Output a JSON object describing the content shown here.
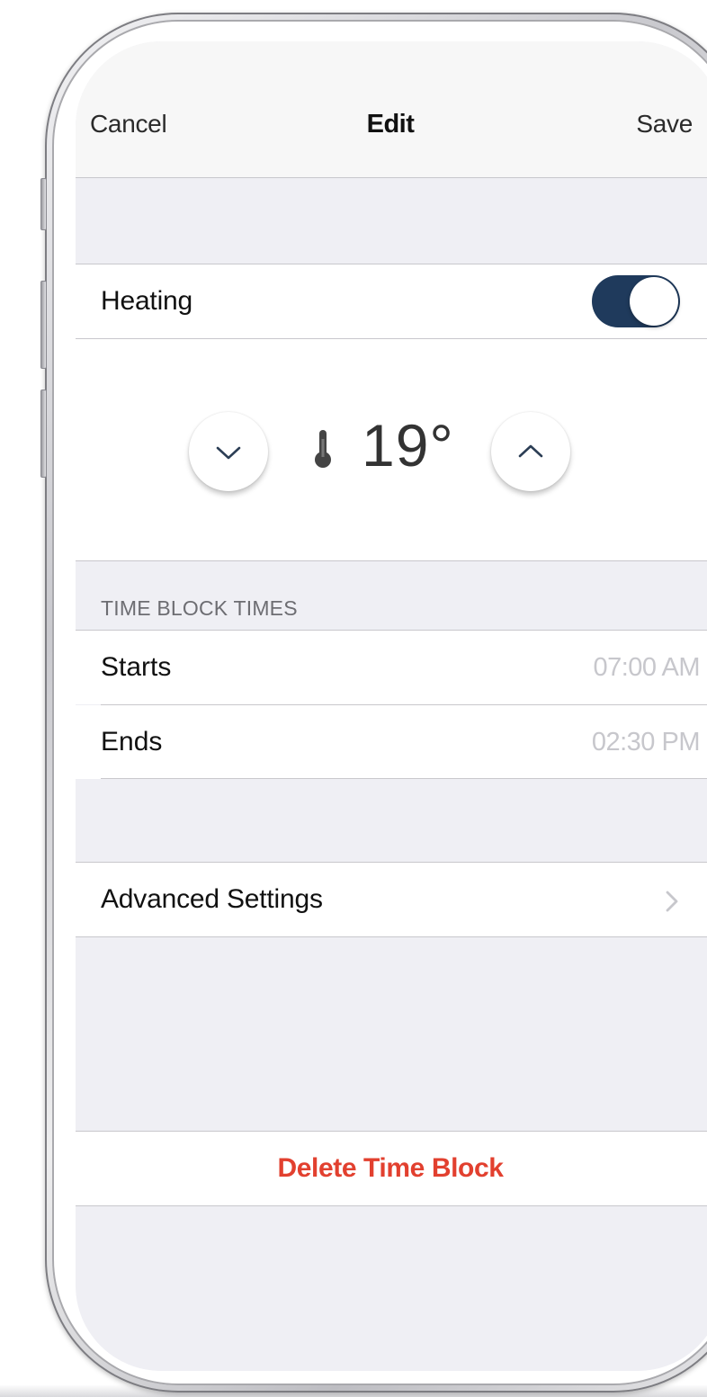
{
  "nav": {
    "cancel_label": "Cancel",
    "title": "Edit",
    "save_label": "Save"
  },
  "heating": {
    "label": "Heating",
    "enabled": true,
    "toggle_color": "#1f3a5c"
  },
  "temperature": {
    "value": "19°",
    "decrease_icon": "chevron-down-icon",
    "increase_icon": "chevron-up-icon",
    "thermometer_icon": "thermometer-icon"
  },
  "time_block": {
    "section_title": "TIME BLOCK TIMES",
    "rows": [
      {
        "label": "Starts",
        "value": "07:00 AM"
      },
      {
        "label": "Ends",
        "value": "02:30 PM"
      }
    ]
  },
  "advanced": {
    "label": "Advanced Settings",
    "icon": "chevron-right-icon"
  },
  "delete": {
    "label": "Delete Time Block",
    "color": "#e2402f"
  }
}
